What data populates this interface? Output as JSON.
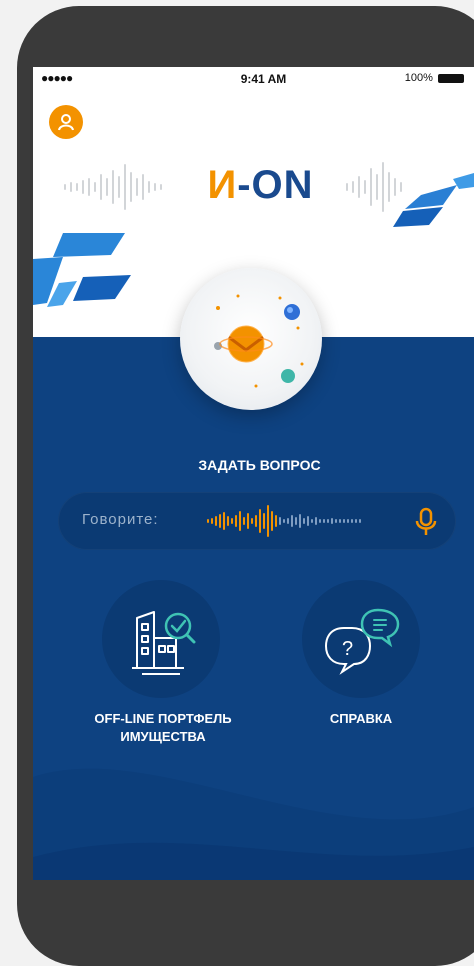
{
  "status_bar": {
    "signal": "●●●●●",
    "time": "9:41 AM",
    "battery": "100%"
  },
  "header": {
    "logo_prefix": "И",
    "logo_suffix": "-ON"
  },
  "main": {
    "ask_label": "ЗАДАТЬ ВОПРОС",
    "voice": {
      "label": "Говорите:"
    },
    "actions": [
      {
        "label_line1": "OFF-LINE ПОРТФЕЛЬ",
        "label_line2": "ИМУЩЕСТВА",
        "icon": "building-check-icon"
      },
      {
        "label_line1": "СПРАВКА",
        "icon": "help-chat-icon"
      }
    ]
  },
  "colors": {
    "accent_orange": "#f39200",
    "brand_blue": "#1a4a8e",
    "panel_blue": "#0e4281",
    "button_blue": "#0b3a73"
  }
}
